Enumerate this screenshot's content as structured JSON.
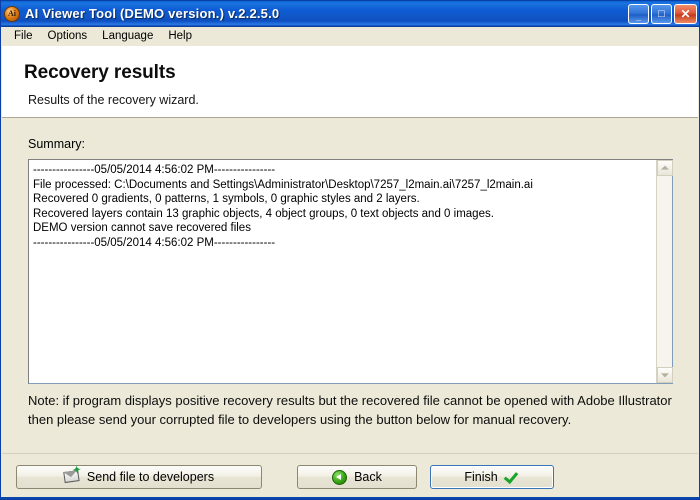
{
  "window": {
    "title": "AI Viewer Tool (DEMO version.) v.2.2.5.0",
    "app_icon": "ai-app-icon",
    "minimize_glyph": "_",
    "maximize_glyph": "□",
    "close_glyph": "✕",
    "titlebar_color": "#0d5ad4",
    "body_color": "#ece9d8"
  },
  "menubar": {
    "items": [
      {
        "label": "File"
      },
      {
        "label": "Options"
      },
      {
        "label": "Language"
      },
      {
        "label": "Help"
      }
    ]
  },
  "header": {
    "title": "Recovery results",
    "subtitle": "Results of the recovery wizard."
  },
  "main": {
    "summary_label": "Summary:",
    "summary_lines": [
      "----------------05/05/2014 4:56:02 PM----------------",
      "File processed: C:\\Documents and Settings\\Administrator\\Desktop\\7257_l2main.ai\\7257_l2main.ai",
      "Recovered 0 gradients, 0 patterns, 1 symbols, 0 graphic styles and 2 layers.",
      "Recovered layers contain 13 graphic objects, 4 object groups, 0 text objects and 0 images.",
      "DEMO version cannot save recovered files",
      "----------------05/05/2014 4:56:02 PM----------------"
    ],
    "note": "Note: if program displays positive recovery results but the recovered file cannot be opened with Adobe Illustrator then please send your corrupted file to developers using the button below for manual recovery.",
    "scrollbar": {
      "up_arrow": "scroll-up-arrow-icon",
      "down_arrow": "scroll-down-arrow-icon"
    }
  },
  "buttons": {
    "send": {
      "label": "Send file to developers",
      "icon": "send-mail-icon"
    },
    "back": {
      "label": "Back",
      "icon": "back-arrow-icon"
    },
    "finish": {
      "label": "Finish",
      "icon": "check-mark-icon",
      "default": true,
      "focus_color": "#3a74b8"
    }
  }
}
